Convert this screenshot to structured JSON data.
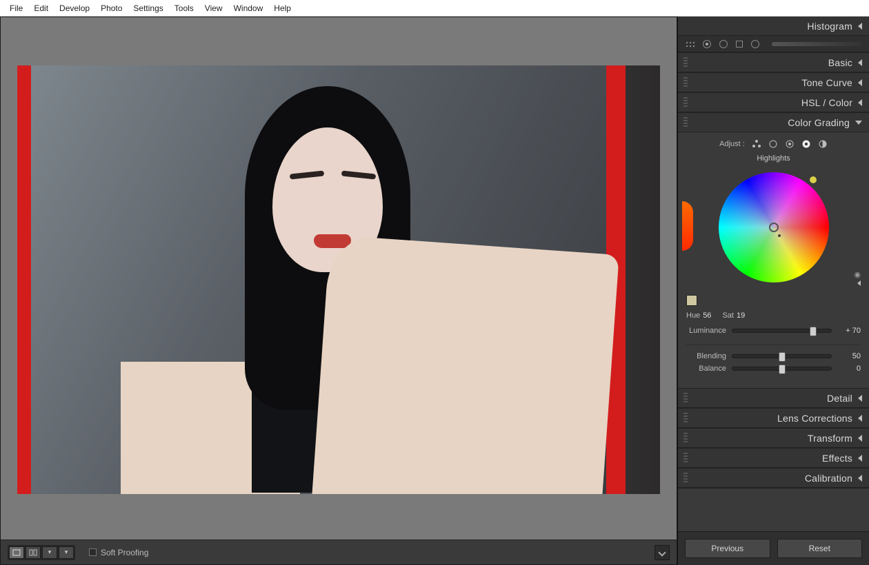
{
  "menu": [
    "File",
    "Edit",
    "Develop",
    "Photo",
    "Settings",
    "Tools",
    "View",
    "Window",
    "Help"
  ],
  "bottom": {
    "soft_proofing": "Soft Proofing"
  },
  "rightpanel": {
    "sections": {
      "histogram": "Histogram",
      "basic": "Basic",
      "tone_curve": "Tone Curve",
      "hsl": "HSL",
      "color_suffix": "Color",
      "color_grading": "Color Grading",
      "detail": "Detail",
      "lens": "Lens Corrections",
      "transform": "Transform",
      "effects": "Effects",
      "calibration": "Calibration"
    },
    "color_grading": {
      "adjust_label": "Adjust :",
      "subtitle": "Highlights",
      "hue_label": "Hue",
      "hue_value": "56",
      "sat_label": "Sat",
      "sat_value": "19",
      "luminance_label": "Luminance",
      "luminance_value": "+ 70",
      "luminance_pct": 82,
      "blending_label": "Blending",
      "blending_value": "50",
      "blending_pct": 50,
      "balance_label": "Balance",
      "balance_value": "0",
      "balance_pct": 50
    },
    "footer": {
      "previous": "Previous",
      "reset": "Reset"
    }
  }
}
